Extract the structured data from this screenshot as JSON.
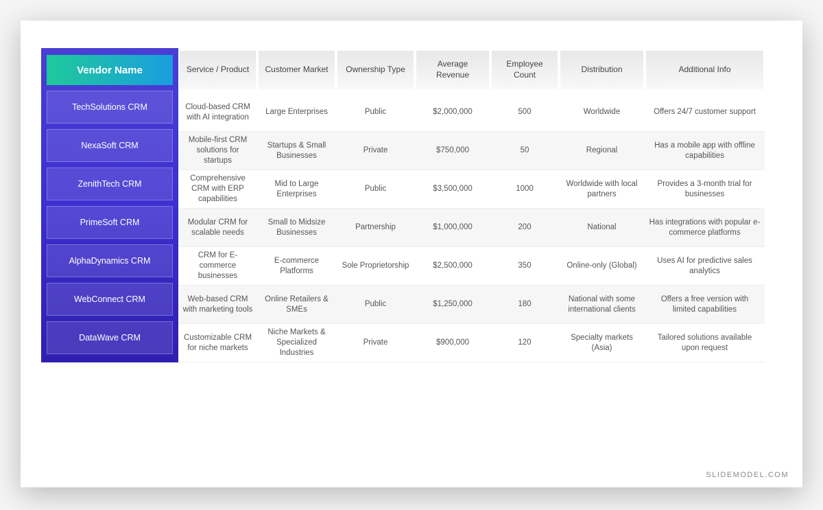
{
  "watermark": "SLIDEMODEL.COM",
  "sidebar": {
    "header": "Vendor Name",
    "vendors": [
      "TechSolutions CRM",
      "NexaSoft CRM",
      "ZenithTech CRM",
      "PrimeSoft CRM",
      "AlphaDynamics CRM",
      "WebConnect CRM",
      "DataWave CRM"
    ]
  },
  "columns": [
    "Service / Product",
    "Customer Market",
    "Ownership Type",
    "Average Revenue",
    "Employee Count",
    "Distribution",
    "Additional Info"
  ],
  "rows": [
    {
      "service": "Cloud-based CRM with AI integration",
      "market": "Large Enterprises",
      "ownership": "Public",
      "revenue": "$2,000,000",
      "employees": "500",
      "distribution": "Worldwide",
      "info": "Offers 24/7 customer support"
    },
    {
      "service": "Mobile-first CRM solutions for startups",
      "market": "Startups & Small Businesses",
      "ownership": "Private",
      "revenue": "$750,000",
      "employees": "50",
      "distribution": "Regional",
      "info": "Has a mobile app with offline capabilities"
    },
    {
      "service": "Comprehensive CRM with ERP capabilities",
      "market": "Mid to Large Enterprises",
      "ownership": "Public",
      "revenue": "$3,500,000",
      "employees": "1000",
      "distribution": "Worldwide with local partners",
      "info": "Provides a 3-month trial for businesses"
    },
    {
      "service": "Modular CRM for scalable needs",
      "market": "Small to Midsize Businesses",
      "ownership": "Partnership",
      "revenue": "$1,000,000",
      "employees": "200",
      "distribution": "National",
      "info": "Has integrations with popular e-commerce platforms"
    },
    {
      "service": "CRM for E-commerce businesses",
      "market": "E-commerce Platforms",
      "ownership": "Sole Proprietorship",
      "revenue": "$2,500,000",
      "employees": "350",
      "distribution": "Online-only (Global)",
      "info": "Uses AI for predictive sales analytics"
    },
    {
      "service": "Web-based CRM with marketing tools",
      "market": "Online Retailers & SMEs",
      "ownership": "Public",
      "revenue": "$1,250,000",
      "employees": "180",
      "distribution": "National with some international clients",
      "info": "Offers a free version with limited capabilities"
    },
    {
      "service": "Customizable CRM for niche markets",
      "market": "Niche Markets & Specialized Industries",
      "ownership": "Private",
      "revenue": "$900,000",
      "employees": "120",
      "distribution": "Specialty markets (Asia)",
      "info": "Tailored solutions available upon request"
    }
  ]
}
